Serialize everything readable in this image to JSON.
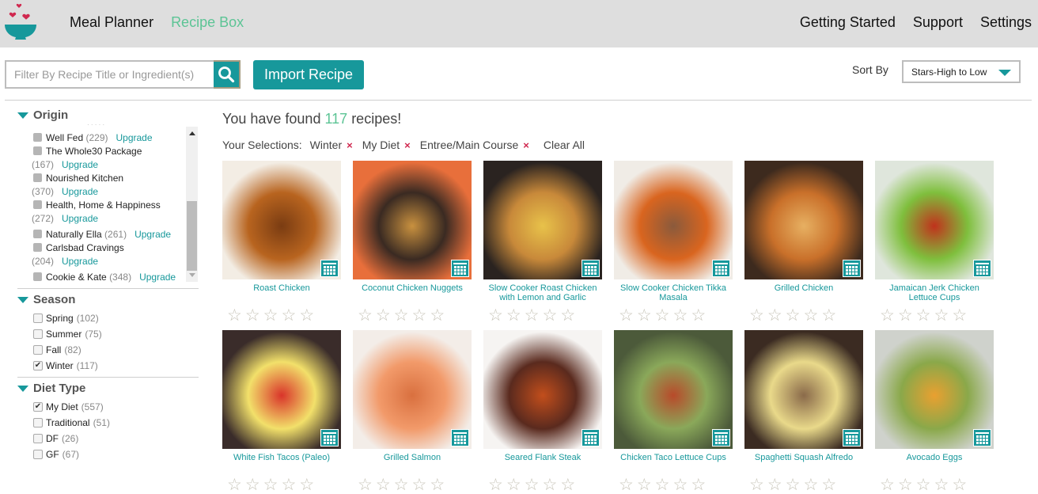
{
  "header": {
    "logo": "bowl-hearts-logo",
    "nav_left": [
      {
        "label": "Meal Planner",
        "active": false
      },
      {
        "label": "Recipe Box",
        "active": true
      }
    ],
    "nav_right": [
      {
        "label": "Getting Started"
      },
      {
        "label": "Support"
      },
      {
        "label": "Settings"
      }
    ]
  },
  "toolbar": {
    "search_placeholder": "Filter By Recipe Title or Ingredient(s)",
    "search_value": "",
    "import_label": "Import Recipe",
    "sort_label": "Sort By",
    "sort_value": "Stars-High to Low"
  },
  "sidebar": {
    "origin": {
      "title": "Origin",
      "items": [
        {
          "name": "Well Fed",
          "count": "(229)",
          "upgrade": "Upgrade"
        },
        {
          "name": "The Whole30 Package",
          "count": "(167)",
          "upgrade": "Upgrade"
        },
        {
          "name": "Nourished Kitchen",
          "count": "(370)",
          "upgrade": "Upgrade"
        },
        {
          "name": "Health, Home & Happiness",
          "count": "(272)",
          "upgrade": "Upgrade"
        },
        {
          "name": "Naturally Ella",
          "count": "(261)",
          "upgrade": "Upgrade"
        },
        {
          "name": "Carlsbad Cravings",
          "count": "(204)",
          "upgrade": "Upgrade"
        },
        {
          "name": "Cookie & Kate",
          "count": "(348)",
          "upgrade": "Upgrade"
        }
      ]
    },
    "season": {
      "title": "Season",
      "items": [
        {
          "name": "Spring",
          "count": "(102)",
          "checked": false
        },
        {
          "name": "Summer",
          "count": "(75)",
          "checked": false
        },
        {
          "name": "Fall",
          "count": "(82)",
          "checked": false
        },
        {
          "name": "Winter",
          "count": "(117)",
          "checked": true
        }
      ]
    },
    "diet": {
      "title": "Diet Type",
      "items": [
        {
          "name": "My Diet",
          "count": "(557)",
          "checked": true
        },
        {
          "name": "Traditional",
          "count": "(51)",
          "checked": false
        },
        {
          "name": "DF",
          "count": "(26)",
          "checked": false
        },
        {
          "name": "GF",
          "count": "(67)",
          "checked": false
        }
      ]
    }
  },
  "results": {
    "prefix": "You have found",
    "count": "117",
    "suffix": "recipes!",
    "selections_label": "Your Selections:",
    "selections": [
      "Winter",
      "My Diet",
      "Entree/Main Course"
    ],
    "remove_icon": "×",
    "clear_all": "Clear All"
  },
  "recipes": [
    {
      "title": "Roast Chicken",
      "rating": 0,
      "colors": [
        "#f3ede4",
        "#b8641f",
        "#7a3c12"
      ]
    },
    {
      "title": "Coconut Chicken Nuggets",
      "rating": 0,
      "colors": [
        "#e86f3b",
        "#3a2a22",
        "#c9913f"
      ]
    },
    {
      "title": "Slow Cooker Roast Chicken with Lemon and Garlic",
      "rating": 0,
      "colors": [
        "#2a2320",
        "#c8893a",
        "#e8c24a"
      ]
    },
    {
      "title": "Slow Cooker Chicken Tikka Masala",
      "rating": 0,
      "colors": [
        "#f0ece6",
        "#d9651f",
        "#8a5a3c"
      ]
    },
    {
      "title": "Grilled Chicken",
      "rating": 0,
      "colors": [
        "#3d2a1e",
        "#c9702a",
        "#e7b062"
      ]
    },
    {
      "title": "Jamaican Jerk Chicken Lettuce Cups",
      "rating": 0,
      "colors": [
        "#dfe6dc",
        "#7fbf3d",
        "#c0321c"
      ]
    },
    {
      "title": "White Fish Tacos (Paleo)",
      "rating": 0,
      "colors": [
        "#3a2c2a",
        "#f2e06a",
        "#d9342a"
      ]
    },
    {
      "title": "Grilled Salmon",
      "rating": 0,
      "colors": [
        "#f3ede8",
        "#f29a6a",
        "#d9703f"
      ]
    },
    {
      "title": "Seared Flank Steak",
      "rating": 0,
      "colors": [
        "#f6f4f2",
        "#5a2a1e",
        "#c24e1c"
      ]
    },
    {
      "title": "Chicken Taco Lettuce Cups",
      "rating": 0,
      "colors": [
        "#4c5a3a",
        "#8aa85a",
        "#b84a2a"
      ]
    },
    {
      "title": "Spaghetti Squash Alfredo",
      "rating": 0,
      "colors": [
        "#3b2b22",
        "#e9d98a",
        "#8a6a4a"
      ]
    },
    {
      "title": "Avocado Eggs",
      "rating": 0,
      "colors": [
        "#cfd2cc",
        "#8aa84a",
        "#e9a030"
      ]
    }
  ],
  "star_glyph": "☆",
  "check_glyph": "✔"
}
